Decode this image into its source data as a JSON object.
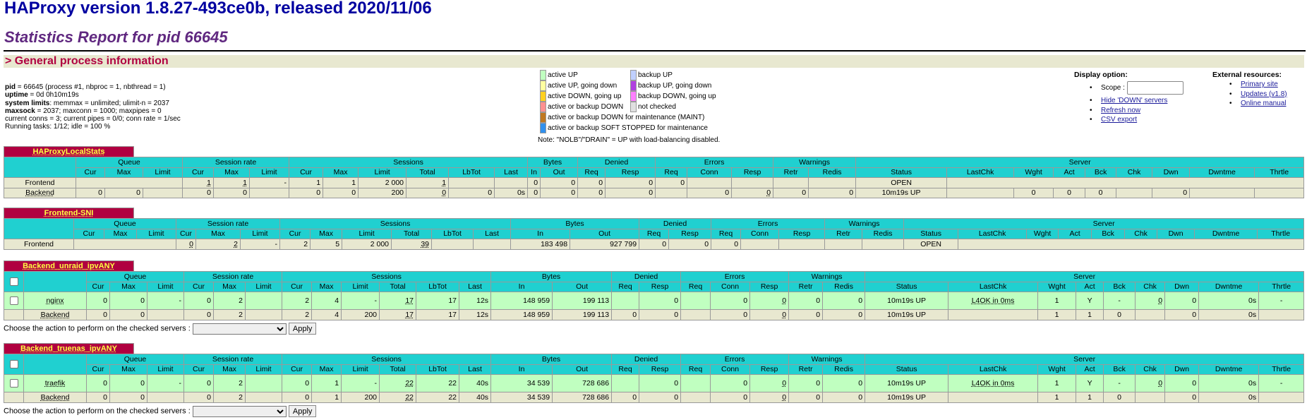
{
  "header": {
    "title": "HAProxy version 1.8.27-493ce0b, released 2020/11/06",
    "subtitle": "Statistics Report for pid 66645"
  },
  "general": {
    "section_title": "> General process information",
    "lines": [
      {
        "k": "pid",
        "v": " = 66645 (process #1, nbproc = 1, nbthread = 1)"
      },
      {
        "k": "uptime",
        "v": " = 0d 0h10m19s"
      },
      {
        "k": "system limits",
        "v": ": memmax = unlimited; ulimit-n = 2037"
      },
      {
        "k": "maxsock",
        "v": " = 2037; maxconn = 1000; maxpipes = 0"
      },
      {
        "k": "",
        "v": "current conns = 3; current pipes = 0/0; conn rate = 1/sec"
      },
      {
        "k": "",
        "v": "Running tasks: 1/12; idle = 100 %"
      }
    ]
  },
  "legend": {
    "left": [
      {
        "label": "active UP",
        "color": "#c0ffc0"
      },
      {
        "label": "active UP, going down",
        "color": "#ffffa0"
      },
      {
        "label": "active DOWN, going up",
        "color": "#ffd020"
      },
      {
        "label": "active or backup DOWN",
        "color": "#ff9090"
      },
      {
        "label": "active or backup DOWN for maintenance (MAINT)",
        "color": "#c07820"
      },
      {
        "label": "active or backup SOFT STOPPED for maintenance",
        "color": "#3090ee"
      }
    ],
    "right": [
      {
        "label": "backup UP",
        "color": "#c0d0ff"
      },
      {
        "label": "backup UP, going down",
        "color": "#b040e0"
      },
      {
        "label": "backup DOWN, going up",
        "color": "#ff80ff"
      },
      {
        "label": "not checked",
        "color": "#e0e0e0"
      }
    ],
    "note": "Note: \"NOLB\"/\"DRAIN\" = UP with load-balancing disabled."
  },
  "display": {
    "title": "Display option:",
    "scope_label": "Scope :",
    "scope_value": "",
    "links": [
      "Hide 'DOWN' servers",
      "Refresh now",
      "CSV export"
    ]
  },
  "external": {
    "title": "External resources:",
    "links": [
      "Primary site",
      "Updates (v1.8)",
      "Online manual"
    ]
  },
  "columns": {
    "groups": [
      "Queue",
      "Session rate",
      "Sessions",
      "Bytes",
      "Denied",
      "Errors",
      "Warnings",
      "Server"
    ],
    "sub": [
      "Cur",
      "Max",
      "Limit",
      "Cur",
      "Max",
      "Limit",
      "Cur",
      "Max",
      "Limit",
      "Total",
      "LbTot",
      "Last",
      "In",
      "Out",
      "Req",
      "Resp",
      "Req",
      "Conn",
      "Resp",
      "Retr",
      "Redis",
      "Status",
      "LastChk",
      "Wght",
      "Act",
      "Bck",
      "Chk",
      "Dwn",
      "Dwntme",
      "Thrtle"
    ]
  },
  "action": {
    "label": "Choose the action to perform on the checked servers :",
    "selected": "",
    "apply": "Apply"
  },
  "tables": [
    {
      "title": "HAProxyLocalStats",
      "checkbox": false,
      "rows": [
        {
          "type": "fe",
          "cells": [
            "Frontend",
            "",
            "",
            "",
            "1",
            "1",
            "-",
            "1",
            "1",
            "2 000",
            "1",
            "",
            "",
            "0",
            "0",
            "0",
            "0",
            "0",
            "",
            "",
            "",
            "",
            "OPEN",
            "",
            "",
            "",
            "",
            "",
            "",
            "",
            ""
          ]
        },
        {
          "type": "be",
          "cells": [
            "Backend",
            "0",
            "0",
            "",
            "0",
            "0",
            "",
            "0",
            "0",
            "200",
            "0",
            "0",
            "0s",
            "0",
            "0",
            "0",
            "0",
            "",
            "0",
            "0",
            "0",
            "0",
            "10m19s UP",
            "",
            "0",
            "0",
            "0",
            "",
            "0",
            "",
            ""
          ]
        }
      ]
    },
    {
      "title": "Frontend-SNI",
      "checkbox": false,
      "rows": [
        {
          "type": "fe",
          "cells": [
            "Frontend",
            "",
            "",
            "",
            "0",
            "2",
            "-",
            "2",
            "5",
            "2 000",
            "39",
            "",
            "",
            "183 498",
            "927 799",
            "0",
            "0",
            "0",
            "",
            "",
            "",
            "",
            "OPEN",
            "",
            "",
            "",
            "",
            "",
            "",
            "",
            ""
          ]
        }
      ]
    },
    {
      "title": "Backend_unraid_ipvANY",
      "checkbox": true,
      "rows": [
        {
          "type": "sv",
          "cells": [
            "nginx",
            "0",
            "0",
            "-",
            "0",
            "2",
            "",
            "2",
            "4",
            "-",
            "17",
            "17",
            "12s",
            "148 959",
            "199 113",
            "",
            "0",
            "",
            "0",
            "0",
            "0",
            "0",
            "10m19s UP",
            "L4OK in 0ms",
            "1",
            "Y",
            "-",
            "0",
            "0",
            "0s",
            "-"
          ]
        },
        {
          "type": "be",
          "cells": [
            "Backend",
            "0",
            "0",
            "",
            "0",
            "2",
            "",
            "2",
            "4",
            "200",
            "17",
            "17",
            "12s",
            "148 959",
            "199 113",
            "0",
            "0",
            "",
            "0",
            "0",
            "0",
            "0",
            "10m19s UP",
            "",
            "1",
            "1",
            "0",
            "",
            "0",
            "0s",
            ""
          ]
        }
      ]
    },
    {
      "title": "Backend_truenas_ipvANY",
      "checkbox": true,
      "rows": [
        {
          "type": "sv",
          "cells": [
            "traefik",
            "0",
            "0",
            "-",
            "0",
            "2",
            "",
            "0",
            "1",
            "-",
            "22",
            "22",
            "40s",
            "34 539",
            "728 686",
            "",
            "0",
            "",
            "0",
            "0",
            "0",
            "0",
            "10m19s UP",
            "L4OK in 0ms",
            "1",
            "Y",
            "-",
            "0",
            "0",
            "0s",
            "-"
          ]
        },
        {
          "type": "be",
          "cells": [
            "Backend",
            "0",
            "0",
            "",
            "0",
            "2",
            "",
            "0",
            "1",
            "200",
            "22",
            "22",
            "40s",
            "34 539",
            "728 686",
            "0",
            "0",
            "",
            "0",
            "0",
            "0",
            "0",
            "10m19s UP",
            "",
            "1",
            "1",
            "0",
            "",
            "0",
            "0s",
            ""
          ]
        }
      ]
    }
  ]
}
